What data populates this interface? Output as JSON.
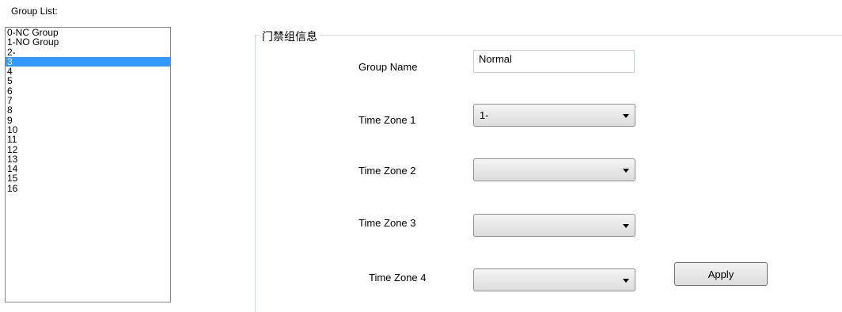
{
  "group_list": {
    "label": "Group List:",
    "items": [
      "0-NC Group",
      "1-NO Group",
      "2-",
      "3",
      "4",
      "5",
      "6",
      "7",
      "8",
      "9",
      "10",
      "11",
      "12",
      "13",
      "14",
      "15",
      "16"
    ],
    "selected": "3"
  },
  "group_info": {
    "title": "门禁组信息",
    "group_name_label": "Group Name",
    "group_name_value": "Normal",
    "time_zones": [
      {
        "label": "Time Zone 1",
        "value": "1-"
      },
      {
        "label": "Time Zone 2",
        "value": ""
      },
      {
        "label": "Time Zone 3",
        "value": ""
      },
      {
        "label": "Time Zone 4",
        "value": ""
      }
    ],
    "apply_label": "Apply"
  },
  "colors": {
    "selection": "#3399ff"
  }
}
